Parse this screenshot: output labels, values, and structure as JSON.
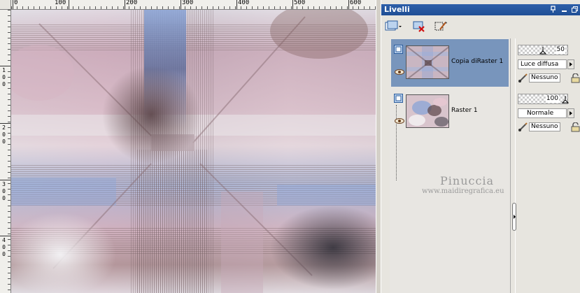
{
  "ruler": {
    "h_labels": [
      "0",
      "100",
      "200",
      "300",
      "400",
      "500",
      "600"
    ],
    "v_labels": [
      [
        "1",
        "0",
        "0"
      ],
      [
        "2",
        "0",
        "0"
      ],
      [
        "3",
        "0",
        "0"
      ],
      [
        "4",
        "0",
        "0"
      ]
    ]
  },
  "palette": {
    "title": "Livelli",
    "layers": [
      {
        "name": "Copia diRaster 1",
        "selected": true,
        "opacity": "50",
        "blend": "Luce diffusa",
        "mask": "Nessuno"
      },
      {
        "name": "Raster 1",
        "selected": false,
        "opacity": "100",
        "blend": "Normale",
        "mask": "Nessuno"
      }
    ]
  },
  "watermark": {
    "name": "Pinuccia",
    "url": "www.maidiregrafica.eu"
  },
  "icons": {
    "new_layer": "new-layer-icon",
    "delete_layer": "delete-layer-icon",
    "edit": "edit-selection-icon",
    "pin": "pin-icon",
    "restore": "restore-icon",
    "eye": "eye-icon",
    "lock": "lock-icon",
    "brush": "brush-icon"
  },
  "colors": {
    "title_bar": "#1f4e95",
    "selected_row": "#7895bc",
    "image_rose": "#d8b4c4",
    "image_blue": "#8ea6d6",
    "image_brown": "#7b5a55"
  }
}
